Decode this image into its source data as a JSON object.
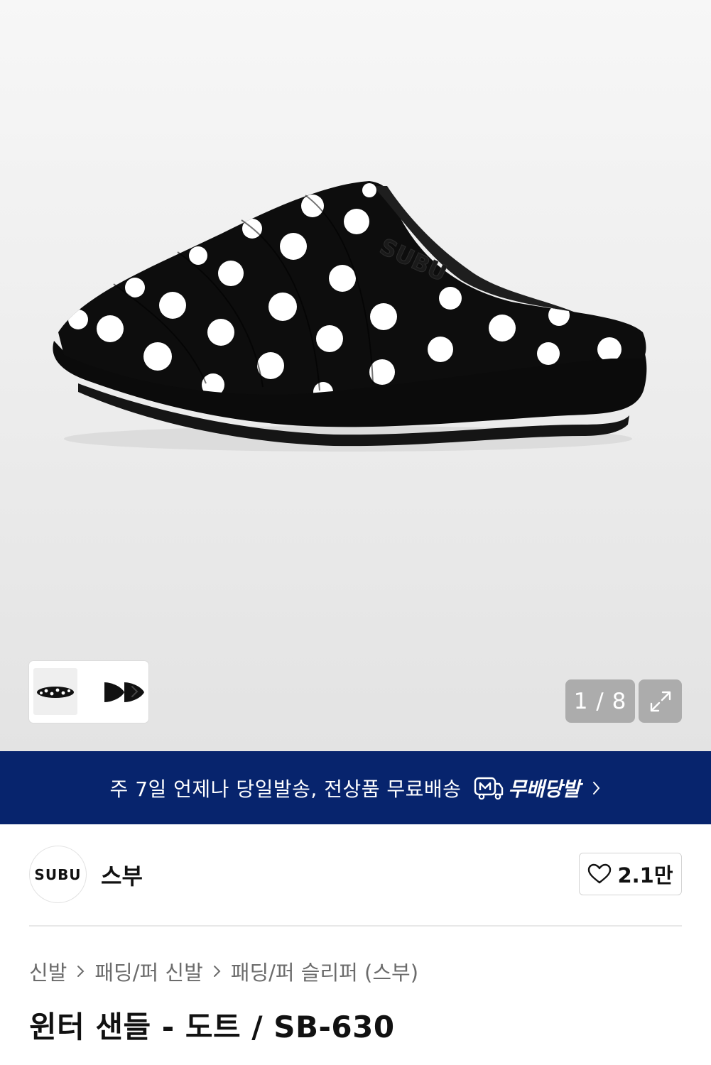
{
  "gallery": {
    "counter": "1 / 8",
    "thumbnail_chevron": "chevron-right-icon",
    "expand_icon": "expand-icon"
  },
  "banner": {
    "text": "주 7일 언제나 당일발송, 전상품 무료배송",
    "logo_text": "무배당발",
    "logo_icon": "m-truck-icon",
    "bg": "#07246d"
  },
  "brand": {
    "logo_text": "SUBU",
    "name": "스부",
    "like_count": "2.1만"
  },
  "breadcrumb": [
    "신발",
    "패딩/퍼 신발",
    "패딩/퍼 슬리퍼 (스부)"
  ],
  "product": {
    "title": "윈터 샌들 - 도트 / SB-630",
    "image_logo_text": "SUBU"
  }
}
